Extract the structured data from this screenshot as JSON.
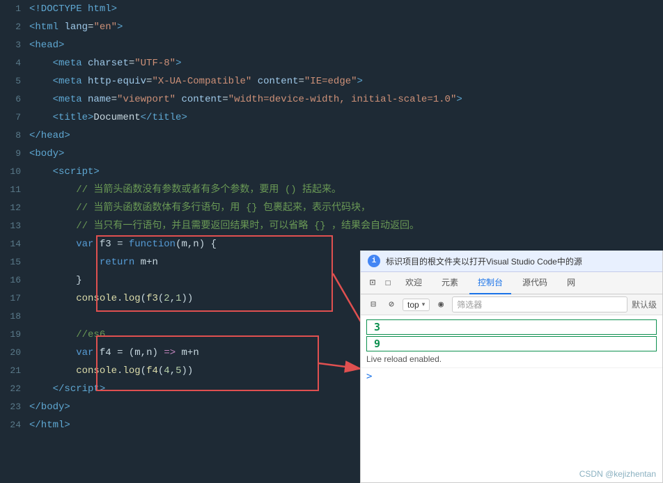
{
  "editor": {
    "background": "#1e2a35",
    "lines": [
      {
        "num": "1",
        "html": "<span class='tag'>&lt;!DOCTYPE html&gt;</span>"
      },
      {
        "num": "2",
        "html": "<span class='tag'>&lt;html</span> <span class='attr'>lang</span><span class='op'>=</span><span class='val'>\"en\"</span><span class='tag'>&gt;</span>"
      },
      {
        "num": "3",
        "html": "<span class='tag'>&lt;head&gt;</span>"
      },
      {
        "num": "4",
        "html": "    <span class='tag'>&lt;meta</span> <span class='attr'>charset</span><span class='op'>=</span><span class='val'>\"UTF-8\"</span><span class='tag'>&gt;</span>"
      },
      {
        "num": "5",
        "html": "    <span class='tag'>&lt;meta</span> <span class='attr'>http-equiv</span><span class='op'>=</span><span class='val'>\"X-UA-Compatible\"</span> <span class='attr'>content</span><span class='op'>=</span><span class='val'>\"IE=edge\"</span><span class='tag'>&gt;</span>"
      },
      {
        "num": "6",
        "html": "    <span class='tag'>&lt;meta</span> <span class='attr'>name</span><span class='op'>=</span><span class='val'>\"viewport\"</span> <span class='attr'>content</span><span class='op'>=</span><span class='val'>\"width=device-width, initial-scale=1.0\"</span><span class='tag'>&gt;</span>"
      },
      {
        "num": "7",
        "html": "    <span class='tag'>&lt;title&gt;</span><span class='plain'>Document</span><span class='tag'>&lt;/title&gt;</span>"
      },
      {
        "num": "8",
        "html": "<span class='tag'>&lt;/head&gt;</span>"
      },
      {
        "num": "9",
        "html": "<span class='tag'>&lt;body&gt;</span>"
      },
      {
        "num": "10",
        "html": "    <span class='tag'>&lt;script&gt;</span>"
      },
      {
        "num": "11",
        "html": "        <span class='comment'>// 当箭头函数没有参数或者有多个参数，要用 () 括起来。</span>"
      },
      {
        "num": "12",
        "html": "        <span class='comment'>// 当箭头函数函数体有多行语句，用 {} 包裹起来，表示代码块，</span>"
      },
      {
        "num": "13",
        "html": "        <span class='comment'>// 当只有一行语句，并且需要返回结果时，可以省略 {} ，结果会自动返回。</span>"
      },
      {
        "num": "14",
        "html": "        <span class='kw'>var</span> <span class='plain'>f3</span> <span class='op'>=</span> <span class='kw'>function</span><span class='op'>(</span><span class='plain'>m,n</span><span class='op'>) {</span>"
      },
      {
        "num": "15",
        "html": "            <span class='kw'>return</span> <span class='plain'>m+n</span>"
      },
      {
        "num": "16",
        "html": "        <span class='op'>}</span>"
      },
      {
        "num": "17",
        "html": "        <span class='fn'>console</span><span class='op'>.</span><span class='fn'>log</span><span class='op'>(</span><span class='fn'>f3</span><span class='op'>(</span><span class='num'>2</span><span class='op'>,</span><span class='num'>1</span><span class='op'>))</span>"
      },
      {
        "num": "18",
        "html": ""
      },
      {
        "num": "19",
        "html": "        <span class='comment'>//es6</span>"
      },
      {
        "num": "20",
        "html": "        <span class='kw'>var</span> <span class='plain'>f4</span> <span class='op'>=</span> <span class='op'>(</span><span class='plain'>m,n</span><span class='op'>)</span> <span class='arrow'>=&gt;</span> <span class='plain'>m+n</span>"
      },
      {
        "num": "21",
        "html": "        <span class='fn'>console</span><span class='op'>.</span><span class='fn'>log</span><span class='op'>(</span><span class='fn'>f4</span><span class='op'>(</span><span class='num'>4</span><span class='op'>,</span><span class='num'>5</span><span class='op'>))</span>"
      },
      {
        "num": "22",
        "html": "    <span class='tag'>&lt;/script&gt;</span>"
      },
      {
        "num": "23",
        "html": "<span class='tag'>&lt;/body&gt;</span>"
      },
      {
        "num": "24",
        "html": "<span class='tag'>&lt;/html&gt;</span>"
      }
    ]
  },
  "devtools": {
    "info_text": "标识项目的根文件夹以打开Visual Studio Code中的源",
    "tabs": [
      "欢迎",
      "元素",
      "控制台",
      "源代码",
      "网"
    ],
    "active_tab": "控制台",
    "toolbar": {
      "top_label": "top",
      "filter_placeholder": "筛选器",
      "default_label": "默认级"
    },
    "console_output": [
      {
        "type": "number",
        "value": "3"
      },
      {
        "type": "number",
        "value": "9"
      }
    ],
    "live_reload": "Live reload enabled."
  },
  "watermark": {
    "text": "CSDN @kejizhentan"
  }
}
